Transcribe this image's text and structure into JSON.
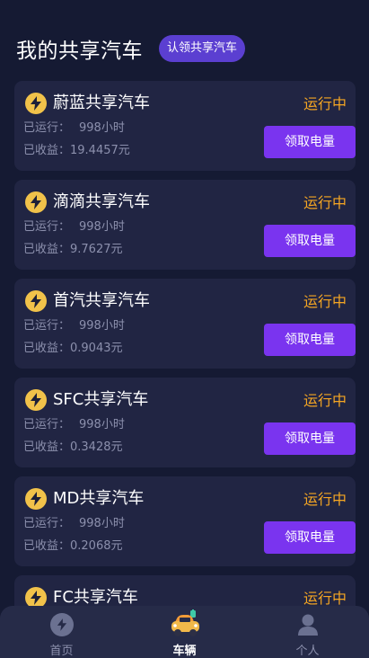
{
  "header": {
    "title": "我的共享汽车",
    "claim_badge": "认领共享汽车"
  },
  "cars": [
    {
      "name": "蔚蓝共享汽车",
      "status": "运行中",
      "runtime_label": "已运行：",
      "runtime_value": "998小时",
      "earnings": "已收益：19.4457元",
      "button": "领取电量"
    },
    {
      "name": "滴滴共享汽车",
      "status": "运行中",
      "runtime_label": "已运行：",
      "runtime_value": "998小时",
      "earnings": "已收益：9.7627元",
      "button": "领取电量"
    },
    {
      "name": "首汽共享汽车",
      "status": "运行中",
      "runtime_label": "已运行：",
      "runtime_value": "998小时",
      "earnings": "已收益：0.9043元",
      "button": "领取电量"
    },
    {
      "name": "SFC共享汽车",
      "status": "运行中",
      "runtime_label": "已运行：",
      "runtime_value": "998小时",
      "earnings": "已收益：0.3428元",
      "button": "领取电量"
    },
    {
      "name": "MD共享汽车",
      "status": "运行中",
      "runtime_label": "已运行：",
      "runtime_value": "998小时",
      "earnings": "已收益：0.2068元",
      "button": "领取电量"
    },
    {
      "name": "FC共享汽车",
      "status": "运行中"
    }
  ],
  "tabbar": {
    "tabs": [
      {
        "label": "首页",
        "icon": "lightning-icon"
      },
      {
        "label": "车辆",
        "icon": "car-icon",
        "active": true
      },
      {
        "label": "个人",
        "icon": "user-icon"
      }
    ]
  },
  "colors": {
    "background": "#151a33",
    "card": "#212543",
    "accent_purple": "#7a34ef",
    "status_orange": "#f5a623",
    "bolt_yellow": "#f1c24a"
  }
}
